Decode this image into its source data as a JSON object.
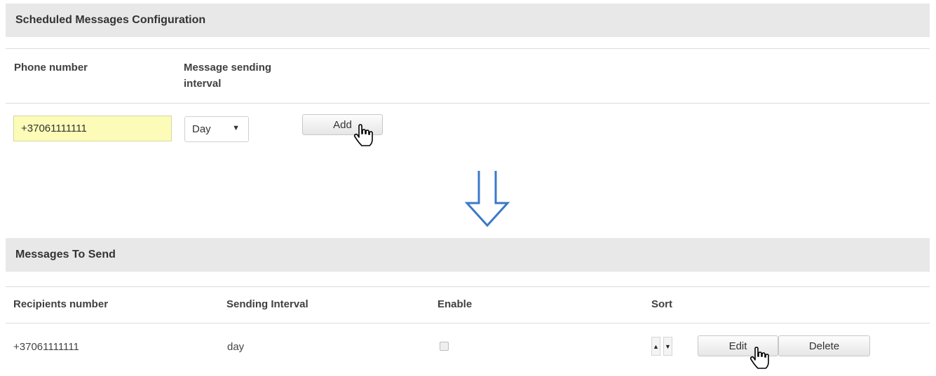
{
  "config_panel": {
    "title": "Scheduled Messages Configuration",
    "columns": {
      "phone": "Phone number",
      "interval_line1": "Message sending",
      "interval_line2": "interval"
    },
    "phone_value": "+37061111111",
    "interval_selected": "Day",
    "add_label": "Add"
  },
  "messages_panel": {
    "title": "Messages To Send",
    "columns": {
      "recipients": "Recipients number",
      "interval": "Sending Interval",
      "enable": "Enable",
      "sort": "Sort"
    },
    "rows": [
      {
        "recipient": "+37061111111",
        "interval": "day",
        "enabled": false
      }
    ],
    "edit_label": "Edit",
    "delete_label": "Delete"
  },
  "icons": {
    "sort_up": "▲",
    "sort_down": "▼",
    "select_caret": "▼"
  }
}
